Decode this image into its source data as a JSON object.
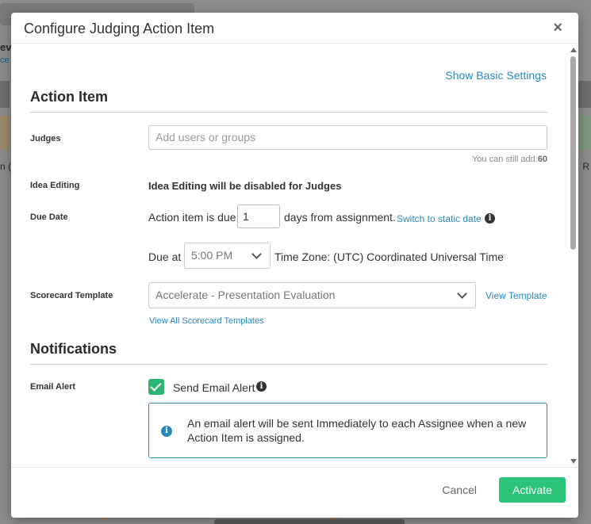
{
  "background": {
    "left_text": "ev",
    "left_link": "ce",
    "left_char": "n (",
    "right_char": "R"
  },
  "modal": {
    "title": "Configure Judging Action Item",
    "close_icon": "×",
    "show_basic_settings": "Show Basic Settings"
  },
  "action_item": {
    "title": "Action Item",
    "judges_label": "Judges",
    "judges_placeholder": "Add users or groups",
    "can_still_add_prefix": "You can still add:",
    "can_still_add_count": "60",
    "idea_editing_label": "Idea Editing",
    "idea_editing_value": "Idea Editing will be disabled for Judges",
    "due_date_label": "Due Date",
    "due_prefix": "Action item is due",
    "due_days": "1",
    "due_suffix": "days from assignment.",
    "switch_static": "Switch to static date",
    "due_at_label": "Due at",
    "due_time": "5:00 PM",
    "timezone": "Time Zone: (UTC) Coordinated Universal Time",
    "scorecard_label": "Scorecard Template",
    "scorecard_value": "Accelerate - Presentation Evaluation",
    "view_template": "View Template",
    "view_all_templates": "View All Scorecard Templates"
  },
  "notifications": {
    "title": "Notifications",
    "email_alert_label": "Email Alert",
    "send_email_alert": "Send Email Alert",
    "send_email_alert_checked": true,
    "alert_message": "An email alert will be sent Immediately to each Assignee when a new Action Item is assigned."
  },
  "footer": {
    "cancel": "Cancel",
    "activate": "Activate"
  },
  "colors": {
    "accent_link": "#2a88bd",
    "primary_button": "#2bc57a",
    "checkbox": "#2bb673"
  }
}
